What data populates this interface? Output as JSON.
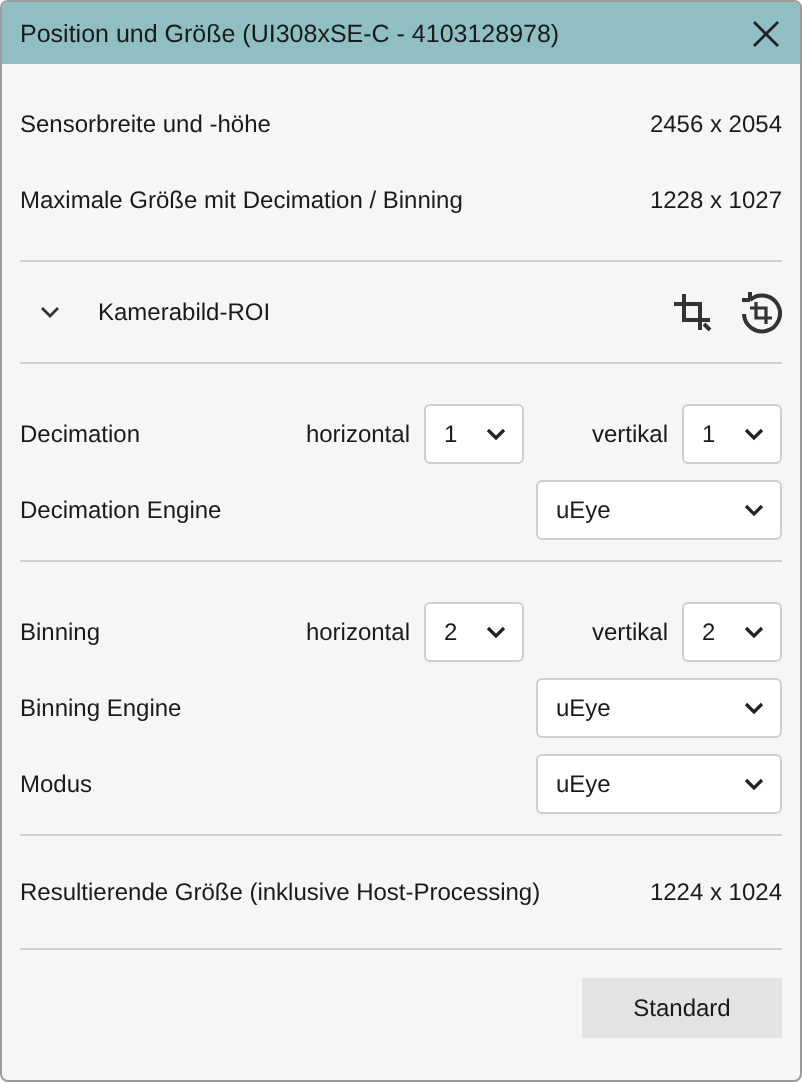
{
  "window": {
    "title": "Position und Größe (UI308xSE-C - 4103128978)"
  },
  "info_rows": [
    {
      "label": "Sensorbreite und -höhe",
      "value": "2456 x 2054"
    },
    {
      "label": "Maximale Größe mit Decimation / Binning",
      "value": "1228 x 1027"
    }
  ],
  "roi_section": {
    "label": "Kamerabild-ROI",
    "expanded": false
  },
  "sections": [
    {
      "rows": [
        {
          "kind": "pair",
          "label": "Decimation",
          "horizontal": {
            "label": "horizontal",
            "value": "1"
          },
          "vertical": {
            "label": "vertikal",
            "value": "1"
          }
        },
        {
          "kind": "select",
          "label": "Decimation Engine",
          "value": "uEye"
        }
      ]
    },
    {
      "rows": [
        {
          "kind": "pair",
          "label": "Binning",
          "horizontal": {
            "label": "horizontal",
            "value": "2"
          },
          "vertical": {
            "label": "vertikal",
            "value": "2"
          }
        },
        {
          "kind": "select",
          "label": "Binning Engine",
          "value": "uEye"
        },
        {
          "kind": "select",
          "label": "Modus",
          "value": "uEye"
        }
      ]
    }
  ],
  "result": {
    "label": "Resultierende Größe (inklusive Host-Processing)",
    "value": "1224 x 1024"
  },
  "buttons": [
    "Standard"
  ]
}
